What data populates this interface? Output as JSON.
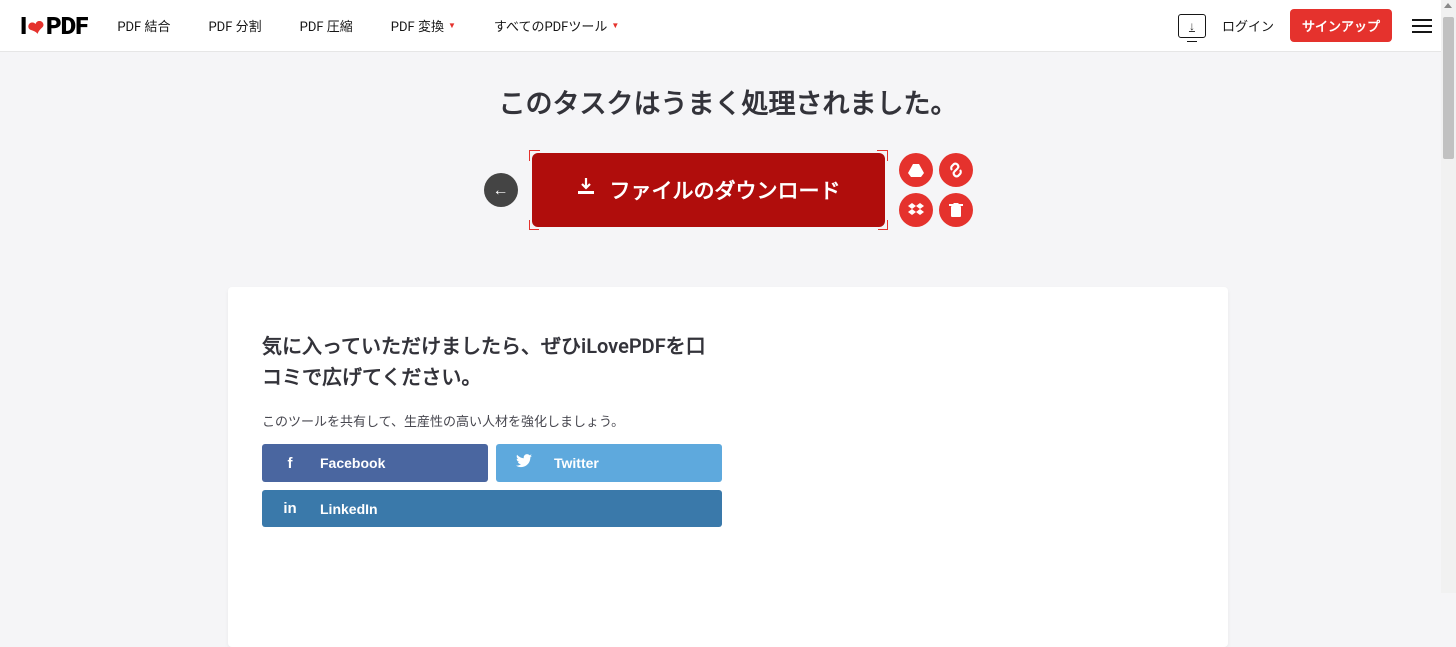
{
  "logo": {
    "i": "I",
    "pdf": "PDF"
  },
  "nav": {
    "merge": "PDF 結合",
    "split": "PDF 分割",
    "compress": "PDF 圧縮",
    "convert": "PDF 変換",
    "all": "すべてのPDFツール"
  },
  "auth": {
    "login": "ログイン",
    "signup": "サインアップ"
  },
  "headline": "このタスクはうまく処理されました。",
  "download_label": "ファイルのダウンロード",
  "card": {
    "title": "気に入っていただけましたら、ぜひiLovePDFを口コミで広げてください。",
    "sub": "このツールを共有して、生産性の高い人材を強化しましょう。"
  },
  "share": {
    "facebook": "Facebook",
    "twitter": "Twitter",
    "linkedin": "LinkedIn"
  },
  "side_icons": {
    "drive": "drive-icon",
    "link": "link-icon",
    "dropbox": "dropbox-icon",
    "delete": "trash-icon"
  }
}
